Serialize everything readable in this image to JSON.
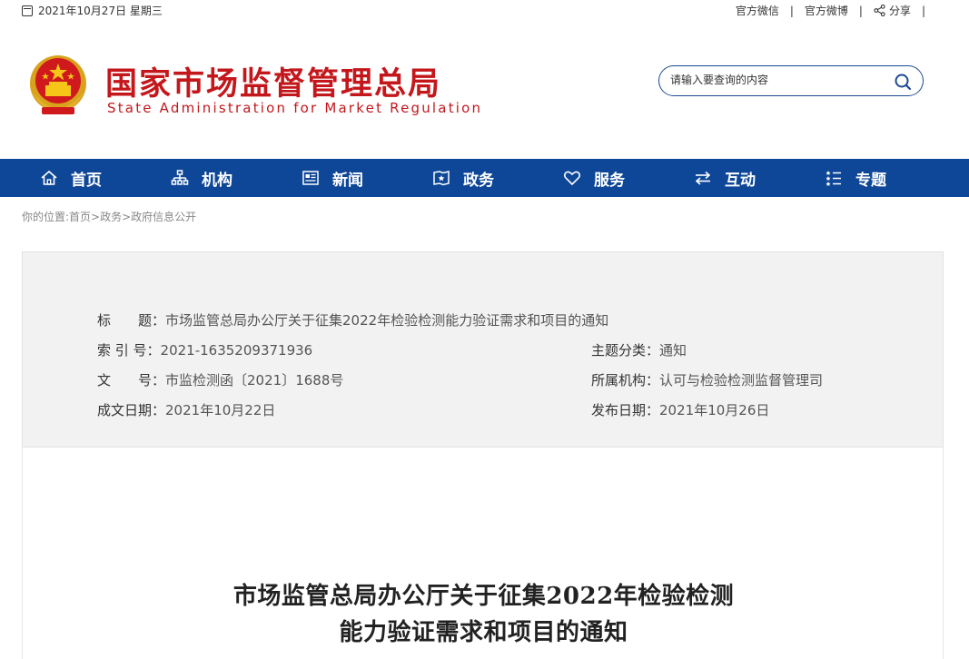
{
  "topbar": {
    "date": "2021年10月27日 星期三",
    "links": [
      "官方微信",
      "官方微博"
    ],
    "separator": "|",
    "share": "分享"
  },
  "header": {
    "title_cn": "国家市场监督管理总局",
    "title_en": "State Administration for Market Regulation",
    "search_placeholder": "请输入要查询的内容"
  },
  "nav": [
    {
      "label": "首页",
      "icon": "home-icon"
    },
    {
      "label": "机构",
      "icon": "org-icon"
    },
    {
      "label": "新闻",
      "icon": "news-icon"
    },
    {
      "label": "政务",
      "icon": "gov-icon"
    },
    {
      "label": "服务",
      "icon": "heart-icon"
    },
    {
      "label": "互动",
      "icon": "exchange-icon"
    },
    {
      "label": "专题",
      "icon": "topic-icon"
    }
  ],
  "breadcrumb": "你的位置:首页>政务>政府信息公开",
  "info": {
    "title_label": "标　　题：",
    "title_value": "市场监管总局办公厅关于征集2022年检验检测能力验证需求和项目的通知",
    "index_label": "索 引 号：",
    "index_value": "2021-1635209371936",
    "category_label": "主题分类：",
    "category_value": "通知",
    "doc_label": "文　　号：",
    "doc_value": "市监检测函〔2021〕1688号",
    "org_label": "所属机构：",
    "org_value": "认可与检验检测监督管理司",
    "created_label": "成文日期：",
    "created_value": "2021年10月22日",
    "published_label": "发布日期：",
    "published_value": "2021年10月26日"
  },
  "article": {
    "title_line1": "市场监管总局办公厅关于征集2022年检验检测",
    "title_line2": "能力验证需求和项目的通知"
  },
  "colors": {
    "brand_red": "#c4171c",
    "nav_blue": "#0e4797"
  }
}
